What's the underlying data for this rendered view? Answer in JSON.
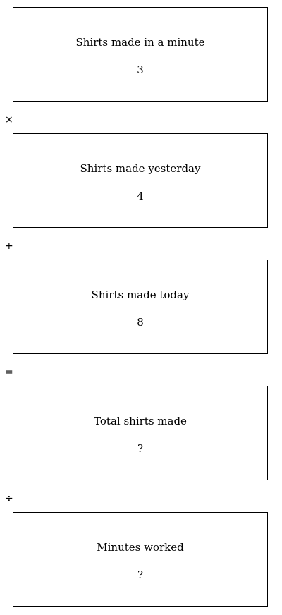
{
  "cards": [
    {
      "label": "Shirts made in a minute",
      "value": "3"
    },
    {
      "label": "Shirts made yesterday",
      "value": "4"
    },
    {
      "label": "Shirts made today",
      "value": "8"
    },
    {
      "label": "Total shirts made",
      "value": "?"
    },
    {
      "label": "Minutes worked",
      "value": "?"
    }
  ],
  "operators": [
    "×",
    "+",
    "=",
    "÷"
  ]
}
